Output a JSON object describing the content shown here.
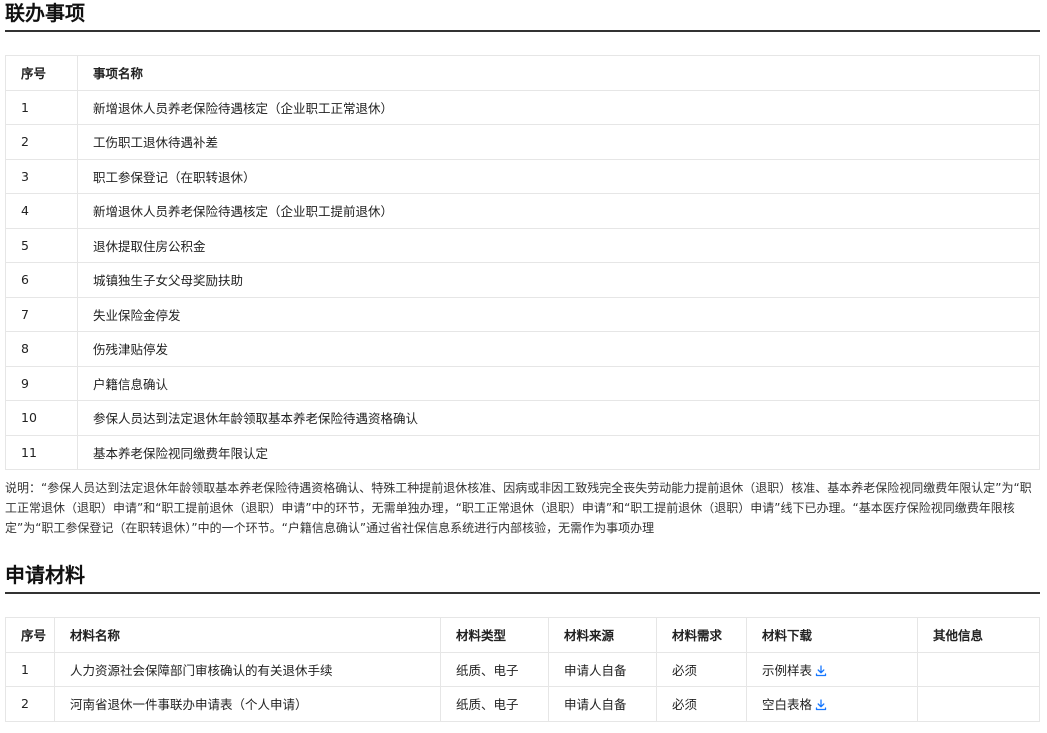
{
  "section1": {
    "title": "联办事项",
    "headers": {
      "no": "序号",
      "name": "事项名称"
    },
    "rows": [
      {
        "no": "1",
        "name": "新增退休人员养老保险待遇核定（企业职工正常退休）"
      },
      {
        "no": "2",
        "name": "工伤职工退休待遇补差"
      },
      {
        "no": "3",
        "name": "职工参保登记（在职转退休）"
      },
      {
        "no": "4",
        "name": "新增退休人员养老保险待遇核定（企业职工提前退休）"
      },
      {
        "no": "5",
        "name": "退休提取住房公积金"
      },
      {
        "no": "6",
        "name": "城镇独生子女父母奖励扶助"
      },
      {
        "no": "7",
        "name": "失业保险金停发"
      },
      {
        "no": "8",
        "name": "伤残津贴停发"
      },
      {
        "no": "9",
        "name": "户籍信息确认"
      },
      {
        "no": "10",
        "name": "参保人员达到法定退休年龄领取基本养老保险待遇资格确认"
      },
      {
        "no": "11",
        "name": "基本养老保险视同缴费年限认定"
      }
    ],
    "note": "说明：“参保人员达到法定退休年龄领取基本养老保险待遇资格确认、特殊工种提前退休核准、因病或非因工致残完全丧失劳动能力提前退休（退职）核准、基本养老保险视同缴费年限认定”为“职工正常退休（退职）申请”和“职工提前退休（退职）申请”中的环节，无需单独办理，“职工正常退休（退职）申请”和“职工提前退休（退职）申请”线下已办理。“基本医疗保险视同缴费年限核定”为“职工参保登记（在职转退休）”中的一个环节。“户籍信息确认”通过省社保信息系统进行内部核验，无需作为事项办理"
  },
  "section2": {
    "title": "申请材料",
    "headers": {
      "no": "序号",
      "name": "材料名称",
      "type": "材料类型",
      "source": "材料来源",
      "requirement": "材料需求",
      "download": "材料下载",
      "other": "其他信息"
    },
    "rows": [
      {
        "no": "1",
        "name": "人力资源社会保障部门审核确认的有关退休手续",
        "type": "纸质、电子",
        "source": "申请人自备",
        "requirement": "必须",
        "download": "示例样表",
        "other": ""
      },
      {
        "no": "2",
        "name": "河南省退休一件事联办申请表（个人申请）",
        "type": "纸质、电子",
        "source": "申请人自备",
        "requirement": "必须",
        "download": "空白表格",
        "other": ""
      }
    ]
  },
  "colors": {
    "link_icon": "#1677ff",
    "border": "#e6e6e6",
    "rule": "#333333"
  },
  "icons": {
    "download": "download-icon"
  }
}
